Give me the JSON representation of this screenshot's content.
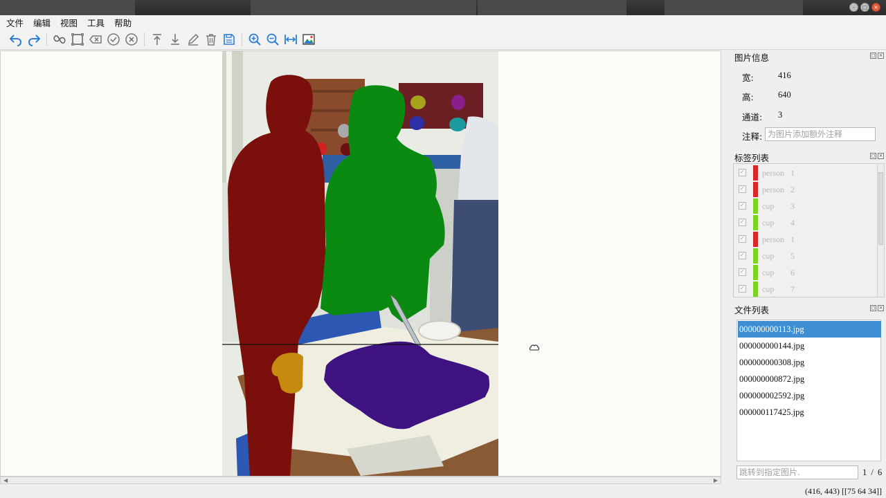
{
  "menu": [
    "文件",
    "编辑",
    "视图",
    "工具",
    "帮助"
  ],
  "toolbar": {
    "icons": [
      "undo-icon",
      "redo-icon",
      "polygon-icon",
      "rectangle-icon",
      "delete-shape-icon",
      "check-icon",
      "cancel-icon",
      "move-top-icon",
      "move-bottom-icon",
      "edit-icon",
      "trash-icon",
      "save-icon",
      "zoom-in-icon",
      "zoom-out-icon",
      "fit-width-icon",
      "image-icon"
    ]
  },
  "image_info": {
    "title": "图片信息",
    "width_label": "宽:",
    "width_value": "416",
    "height_label": "高:",
    "height_value": "640",
    "channels_label": "通道:",
    "channels_value": "3",
    "note_label": "注释:",
    "note_placeholder": "为图片添加额外注释"
  },
  "labels": {
    "title": "标签列表",
    "items": [
      {
        "name": "person",
        "id": "1",
        "color": "#d8262a"
      },
      {
        "name": "person",
        "id": "2",
        "color": "#d8262a"
      },
      {
        "name": "cup",
        "id": "3",
        "color": "#7ed321"
      },
      {
        "name": "cup",
        "id": "4",
        "color": "#7ed321"
      },
      {
        "name": "person",
        "id": "1",
        "color": "#d8262a"
      },
      {
        "name": "cup",
        "id": "5",
        "color": "#7ed321"
      },
      {
        "name": "cup",
        "id": "6",
        "color": "#7ed321"
      },
      {
        "name": "cup",
        "id": "7",
        "color": "#7ed321"
      }
    ]
  },
  "files": {
    "title": "文件列表",
    "items": [
      "000000000113.jpg",
      "000000000144.jpg",
      "000000000308.jpg",
      "000000000872.jpg",
      "000000002592.jpg",
      "000000117425.jpg"
    ],
    "selected": 0,
    "jump_placeholder": "跳转到指定图片.",
    "page": "1",
    "page_sep": "/",
    "total": "6"
  },
  "status": "(416, 443) [[75 64 34]]"
}
